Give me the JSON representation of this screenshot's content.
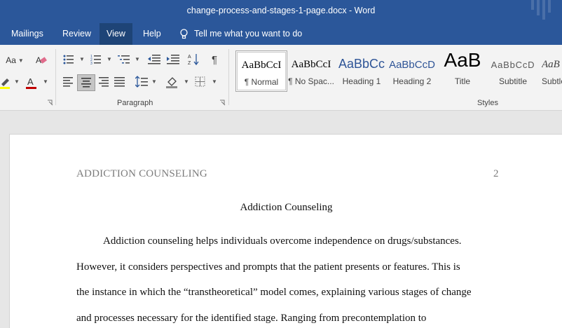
{
  "window": {
    "title": "change-process-and-stages-1-page.docx  -  Word"
  },
  "menu": {
    "tabs": [
      {
        "label": "Mailings"
      },
      {
        "label": "Review"
      },
      {
        "label": "View"
      },
      {
        "label": "Help"
      }
    ],
    "tellme": "Tell me what you want to do"
  },
  "ribbon": {
    "font_size_label": "Aa",
    "paragraph_group": "Paragraph",
    "styles_group": "Styles",
    "styles": [
      {
        "sample": "AaBbCcI",
        "name": "¶ Normal",
        "color": "#000000"
      },
      {
        "sample": "AaBbCcI",
        "name": "¶ No Spac...",
        "color": "#000000"
      },
      {
        "sample": "AaBbCc",
        "name": "Heading 1",
        "color": "#2f5597"
      },
      {
        "sample": "AaBbCcD",
        "name": "Heading 2",
        "color": "#2f5597"
      },
      {
        "sample": "AaB",
        "name": "Title",
        "color": "#000000"
      },
      {
        "sample": "AaBbCcD",
        "name": "Subtitle",
        "color": "#595959"
      },
      {
        "sample": "AaB",
        "name": "Subtle",
        "color": "#404040"
      }
    ]
  },
  "document": {
    "header_left": "ADDICTION COUNSELING",
    "page_number": "2",
    "title": "Addiction Counseling",
    "lines": [
      "Addiction counseling helps individuals overcome independence on drugs/substances.",
      "However, it considers perspectives and prompts that the patient presents or features. This is",
      "the instance in which the “transtheoretical” model comes, explaining various stages of change",
      "and processes necessary for the identified stage. Ranging from precontemplation to"
    ]
  },
  "colors": {
    "word_blue": "#2b579a",
    "active_tab": "#1e4477",
    "font_color_red": "#c00000",
    "highlight_yellow": "#ffff00"
  }
}
